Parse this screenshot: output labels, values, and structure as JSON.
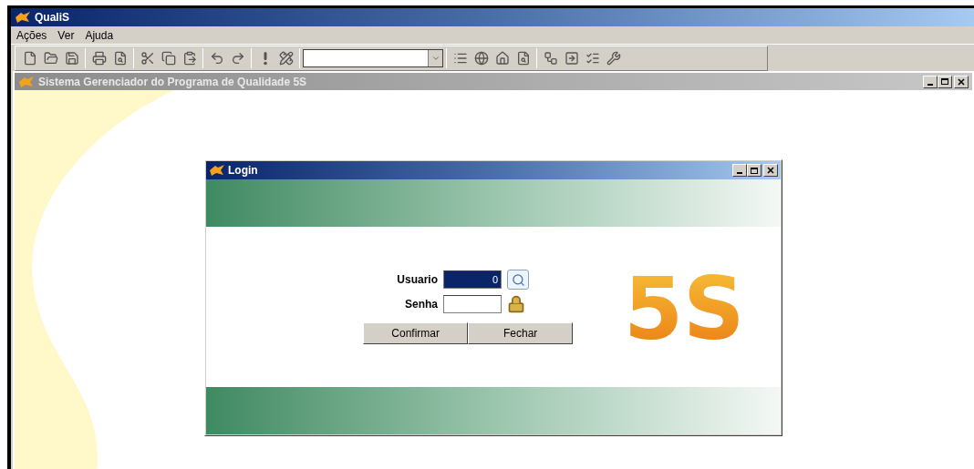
{
  "app": {
    "title": "QualiS"
  },
  "menu": [
    "Ações",
    "Ver",
    "Ajuda"
  ],
  "child_window": {
    "title": "Sistema Gerenciador do Programa de Qualidade 5S"
  },
  "login": {
    "title": "Login",
    "logo": "5S",
    "fields": [
      {
        "label": "Usuario",
        "value": "0",
        "kind": "search",
        "selected": true
      },
      {
        "label": "Senha",
        "kind": "lock",
        "selected": false
      }
    ],
    "buttons": [
      "Confirmar",
      "Fechar"
    ]
  }
}
